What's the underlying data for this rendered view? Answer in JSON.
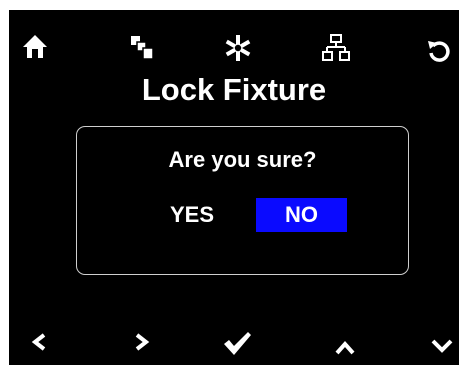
{
  "header": {
    "icons": [
      "home-icon",
      "copy-icon",
      "asterisk-icon",
      "network-icon",
      "undo-icon"
    ],
    "title": "Lock Fixture"
  },
  "dialog": {
    "question": "Are you sure?",
    "yes_label": "YES",
    "no_label": "NO",
    "selected": "NO"
  },
  "footer": {
    "icons": [
      "chevron-left-icon",
      "chevron-right-icon",
      "checkmark-icon",
      "chevron-up-icon",
      "chevron-down-icon"
    ]
  },
  "colors": {
    "background": "#000000",
    "text": "#ffffff",
    "selected": "#0a0aff",
    "dialog_border": "#cfcfcf"
  }
}
